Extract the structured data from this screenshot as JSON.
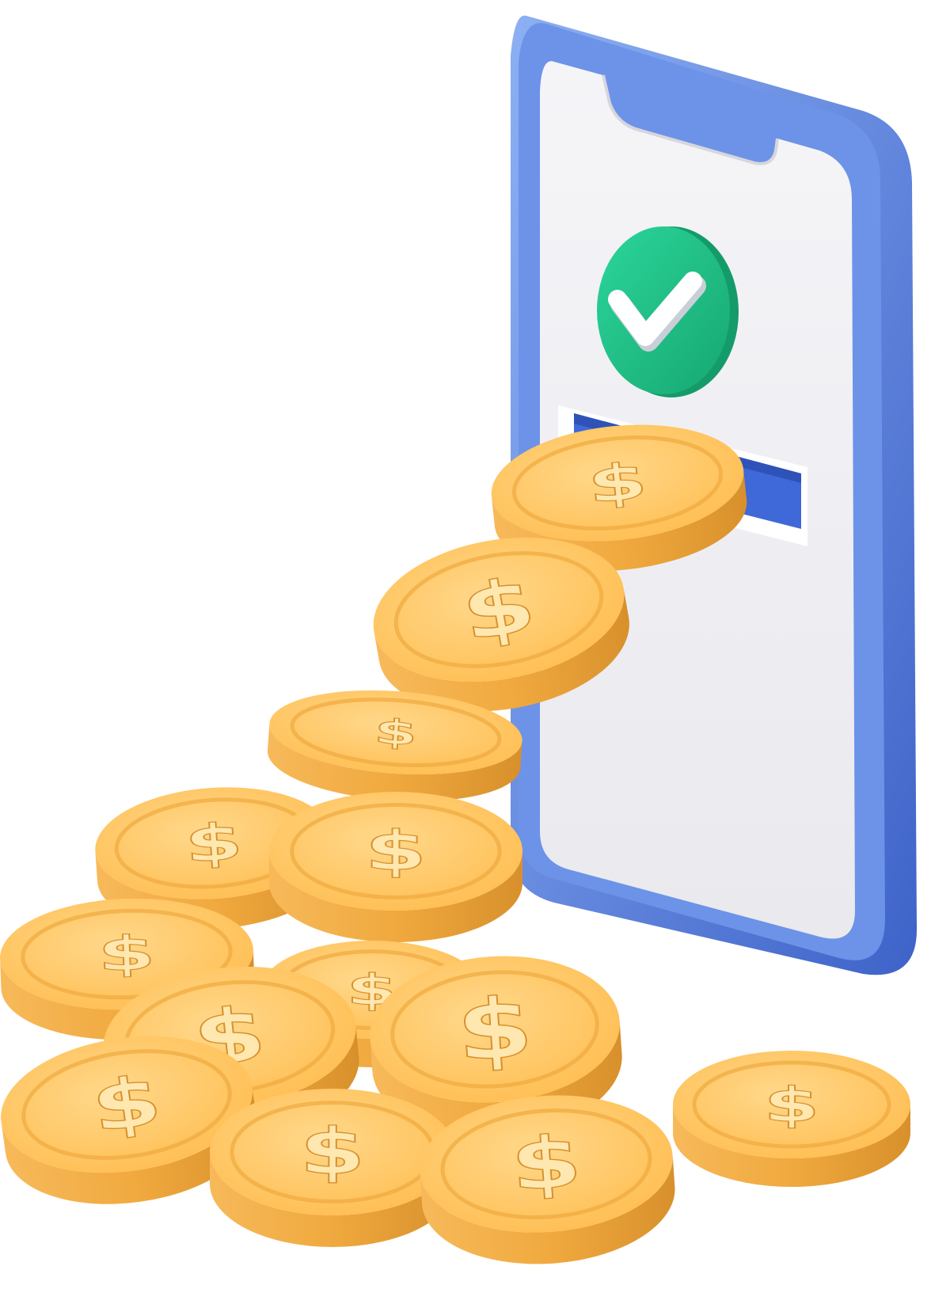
{
  "scene": {
    "description_label": "",
    "phone": {
      "body_color": "#5B83E0",
      "body_light": "#8DB0F3",
      "body_dark": "#3E63C9",
      "screen_color": "#F0F0F3",
      "slot_color": "#3F68D8",
      "checkmark_badge_color": "#22C98A",
      "checkmark_badge_dark": "#17A772",
      "checkmark_color": "#FFFFFF"
    },
    "coin": {
      "face_color": "#FFC35C",
      "face_light": "#FFD88B",
      "edge_color": "#F0A93E",
      "edge_dark": "#D8902C",
      "symbol_color": "#FFE7B0",
      "symbol": "$"
    }
  }
}
